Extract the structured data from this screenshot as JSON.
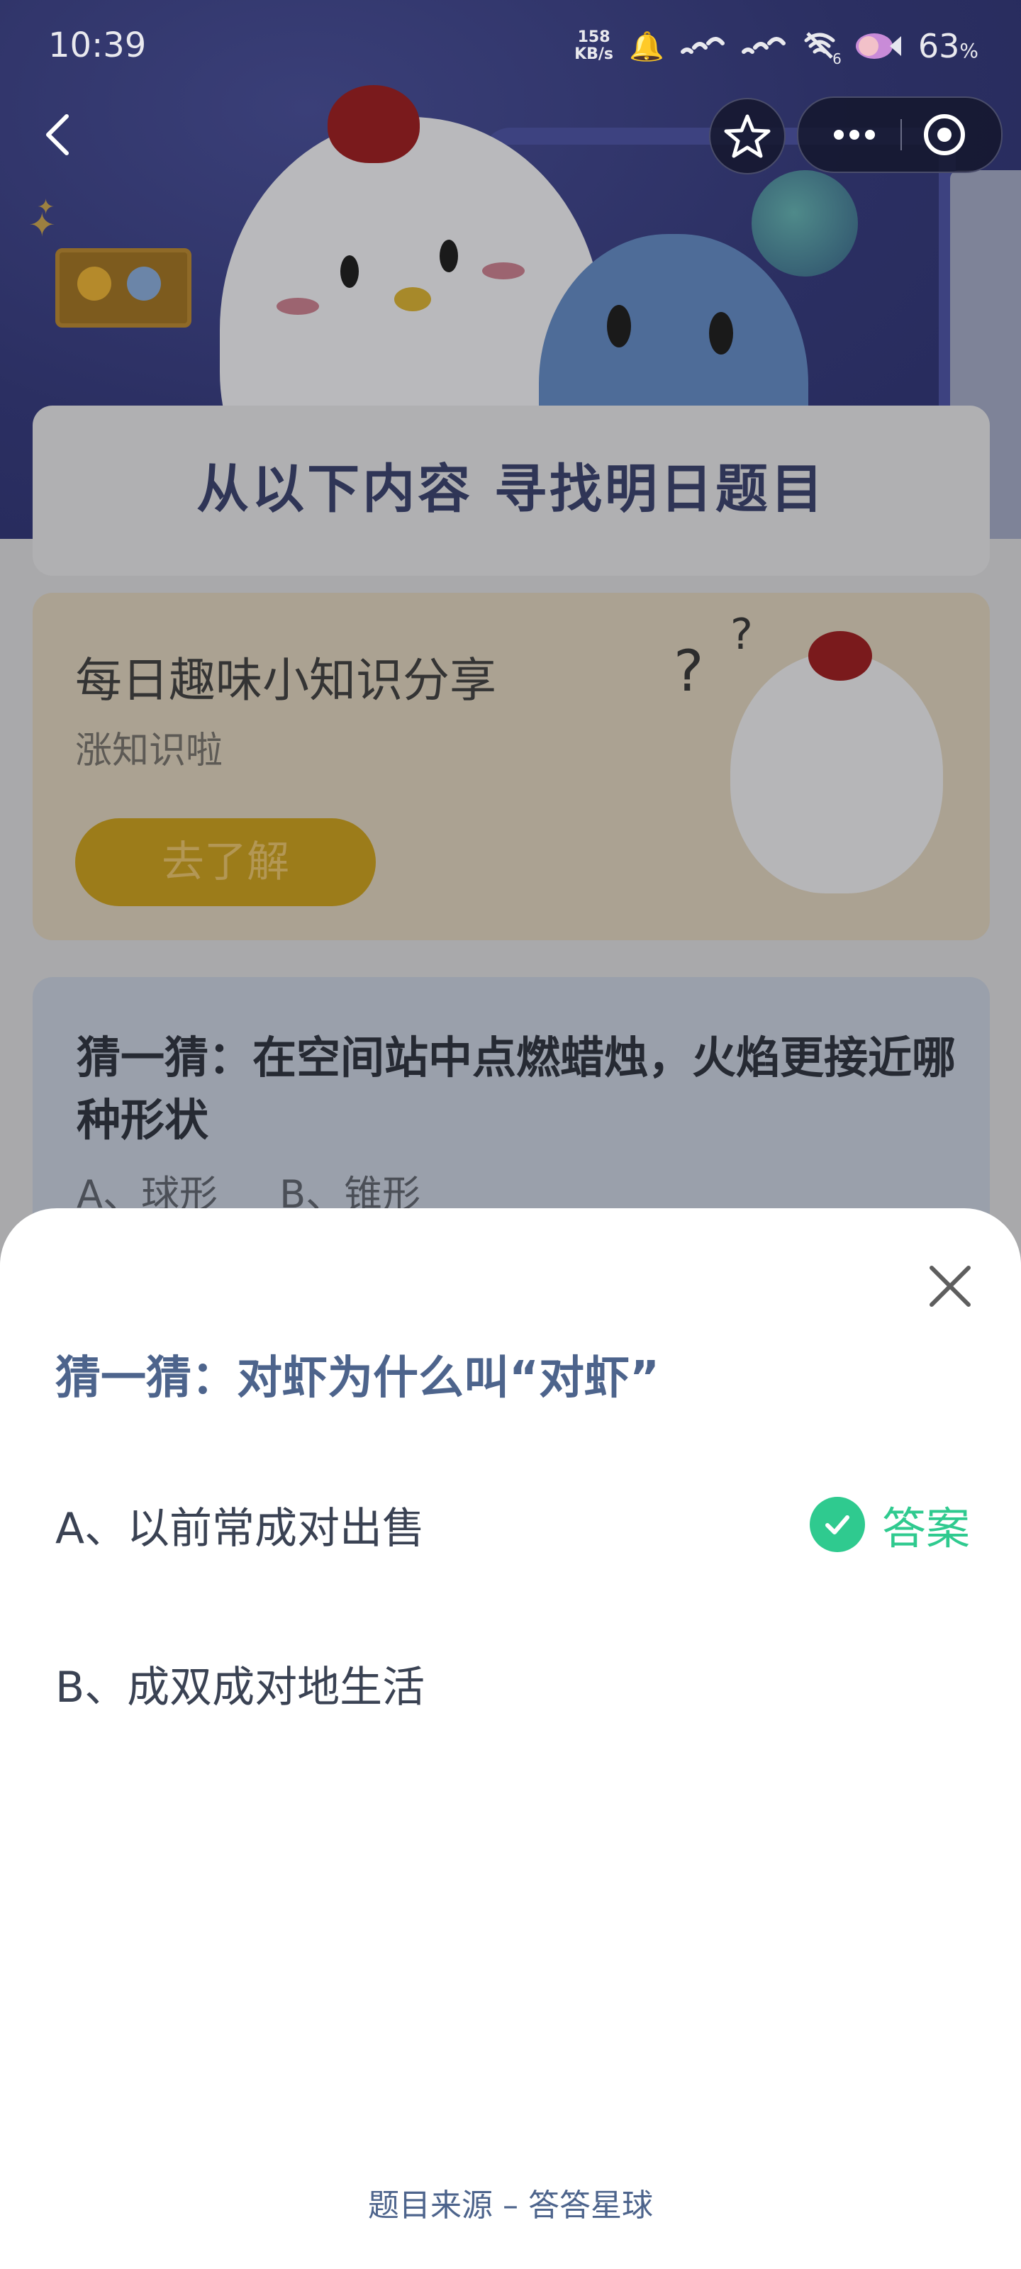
{
  "status_bar": {
    "time": "10:39",
    "net_speed_value": "158",
    "net_speed_unit": "KB/s",
    "signal_sub": "6",
    "battery": "63",
    "battery_unit": "%"
  },
  "background": {
    "section_title": "从以下内容 寻找明日题目",
    "trivia_card": {
      "title": "每日趣味小知识分享",
      "subtitle": "涨知识啦",
      "button": "去了解"
    },
    "quiz_card": {
      "question": "猜一猜：在空间站中点燃蜡烛，火焰更接近哪种形状",
      "option_a": "A、球形",
      "option_b": "B、锥形"
    }
  },
  "sheet": {
    "question": "猜一猜：对虾为什么叫“对虾”",
    "options": [
      {
        "label": "A、以前常成对出售",
        "is_answer": true
      },
      {
        "label": "B、成双成对地生活",
        "is_answer": false
      }
    ],
    "answer_label": "答案",
    "source": "题目来源 – 答答星球"
  },
  "colors": {
    "answer_green": "#2fca8f",
    "question_blue": "#4d648c"
  }
}
